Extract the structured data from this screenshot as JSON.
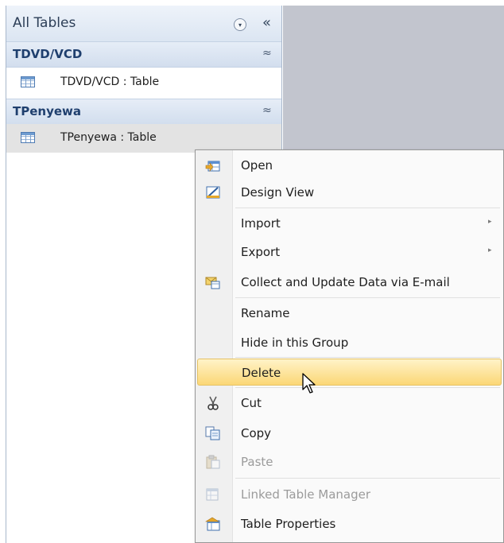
{
  "nav": {
    "title": "All Tables",
    "dropdown_glyph": "▾",
    "collapse_glyph": "«",
    "groups": [
      {
        "name": "TDVD/VCD",
        "chevron": "≈",
        "items": [
          {
            "label": "TDVD/VCD : Table",
            "icon": "table-icon"
          }
        ]
      },
      {
        "name": "TPenyewa",
        "chevron": "≈",
        "items": [
          {
            "label": "TPenyewa : Table",
            "icon": "table-icon"
          }
        ]
      }
    ]
  },
  "context_menu": {
    "items": [
      {
        "label": "Open",
        "icon": "open-table-icon",
        "enabled": true
      },
      {
        "label": "Design View",
        "icon": "design-view-icon",
        "enabled": true
      },
      {
        "label": "Import",
        "submenu": true,
        "enabled": true
      },
      {
        "label": "Export",
        "submenu": true,
        "enabled": true
      },
      {
        "label": "Collect and Update Data via E-mail",
        "icon": "email-collect-icon",
        "enabled": true
      },
      {
        "label": "Rename",
        "enabled": true
      },
      {
        "label": "Hide in this Group",
        "enabled": true
      },
      {
        "label": "Delete",
        "enabled": true,
        "highlighted": true
      },
      {
        "label": "Cut",
        "icon": "scissors-icon",
        "enabled": true
      },
      {
        "label": "Copy",
        "icon": "copy-icon",
        "enabled": true
      },
      {
        "label": "Paste",
        "icon": "paste-icon",
        "enabled": false
      },
      {
        "label": "Linked Table Manager",
        "icon": "linked-table-manager-icon",
        "enabled": false
      },
      {
        "label": "Table Properties",
        "icon": "table-properties-icon",
        "enabled": true
      }
    ],
    "submenu_arrow": "▸"
  },
  "colors": {
    "highlight": "#fbd776",
    "group_title": "#1f3f6e",
    "workspace": "#c2c5ce"
  }
}
